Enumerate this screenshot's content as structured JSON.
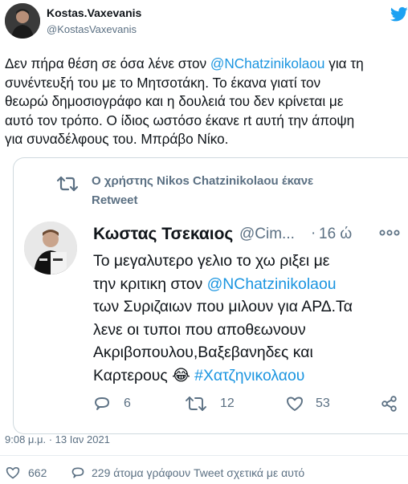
{
  "author": {
    "name": "Kostas.Vaxevanis",
    "handle": "@KostasVaxevanis"
  },
  "tweet": {
    "lines": [
      [
        "Δεν πήρα θέση σε όσα λένε στον ",
        "@NChatzinikolaou",
        " για τη"
      ],
      [
        "συνέντευξή του με το Μητσοτάκη. Το έκανα γιατί τον"
      ],
      [
        "θεωρώ δημοσιογράφο και η δουλειά του δεν κρίνεται με"
      ],
      [
        "αυτό τον τρόπο. Ο ίδιος ωστόσο έκανε rt αυτή την άποψη"
      ],
      [
        "για συναδέλφους του. Μπράβο Νίκο."
      ]
    ]
  },
  "quote": {
    "retweet_notice_line1": "Ο χρήστης Nikos Chatzinikolaou έκανε",
    "retweet_notice_line2": "Retweet",
    "author_name": "Κωστας Τσεκαιος",
    "author_handle": "@Cim...",
    "separator": "·",
    "time": "16 ώ",
    "lines": [
      [
        "Το μεγαλυτερο γελιο το χω ριξει με"
      ],
      [
        "την κριτικη στον ",
        "@NChatzinikolaou"
      ],
      [
        "των Συριζαιων που μιλουν για ΑΡΔ.Τα"
      ],
      [
        "λενε οι τυποι που αποθεωνουν"
      ],
      [
        "Ακριβοπουλου,Βαξεβανηδες και"
      ],
      [
        "Καρτερους ",
        "😂",
        " #Χατζηνικολαου"
      ]
    ],
    "reply_count": "6",
    "retweet_count": "12",
    "like_count": "53"
  },
  "timestamp": "9:08 μ.μ. · 13 Ιαν 2021",
  "stats": {
    "likes": "662",
    "talking": "229 άτομα γράφουν Tweet σχετικά με αυτό"
  },
  "colors": {
    "link": "#1b95e0",
    "muted": "#5b7083",
    "text": "#0f1419",
    "border": "#cfd9de"
  }
}
